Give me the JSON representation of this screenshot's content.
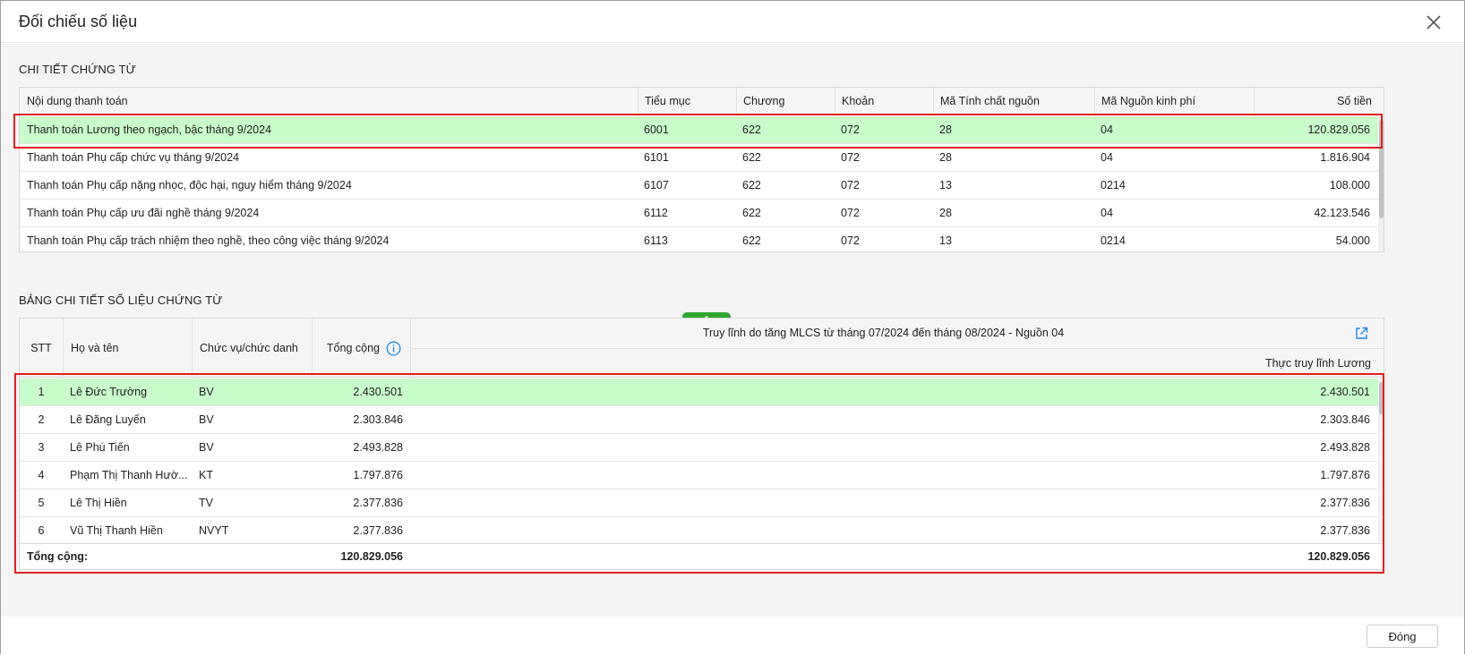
{
  "dialog": {
    "title": "Đối chiếu số liệu",
    "close_label": "Đóng"
  },
  "section1": {
    "title": "CHI TIẾT CHỨNG TỪ",
    "columns": [
      "Nội dung thanh toán",
      "Tiểu mục",
      "Chương",
      "Khoản",
      "Mã Tính chất nguồn",
      "Mã Nguồn kinh phí",
      "Số tiền"
    ],
    "rows": [
      [
        "Thanh toán Lương theo ngạch, bậc tháng 9/2024",
        "6001",
        "622",
        "072",
        "28",
        "04",
        "120.829.056"
      ],
      [
        "Thanh toán Phụ cấp chức vụ tháng 9/2024",
        "6101",
        "622",
        "072",
        "28",
        "04",
        "1.816.904"
      ],
      [
        "Thanh toán Phụ cấp nặng nhọc, độc hại, nguy hiểm tháng 9/2024",
        "6107",
        "622",
        "072",
        "13",
        "0214",
        "108.000"
      ],
      [
        "Thanh toán Phụ cấp ưu đãi nghề tháng 9/2024",
        "6112",
        "622",
        "072",
        "28",
        "04",
        "42.123.546"
      ],
      [
        "Thanh toán Phụ cấp trách nhiệm theo nghề, theo công việc tháng 9/2024",
        "6113",
        "622",
        "072",
        "13",
        "0214",
        "54.000"
      ]
    ]
  },
  "section2": {
    "title": "BẢNG CHI TIẾT SỐ LIỆU CHỨNG TỪ",
    "columns": {
      "stt": "STT",
      "name": "Họ và tên",
      "position": "Chức vụ/chức danh",
      "total": "Tổng cộng"
    },
    "group_header": "Truy lĩnh do tăng MLCS từ tháng 07/2024 đến tháng 08/2024 - Nguồn 04",
    "sub_header": "Thực truy lĩnh Lương",
    "rows": [
      [
        "1",
        "Lê Đức Trường",
        "BV",
        "2.430.501",
        "2.430.501"
      ],
      [
        "2",
        "Lê Đăng Luyến",
        "BV",
        "2.303.846",
        "2.303.846"
      ],
      [
        "3",
        "Lê Phú Tiến",
        "BV",
        "2.493.828",
        "2.493.828"
      ],
      [
        "4",
        "Phạm Thị Thanh Hườ...",
        "KT",
        "1.797.876",
        "1.797.876"
      ],
      [
        "5",
        "Lê Thị Hiền",
        "TV",
        "2.377.836",
        "2.377.836"
      ],
      [
        "6",
        "Vũ Thị Thanh Hiền",
        "NVYT",
        "2.377.836",
        "2.377.836"
      ]
    ],
    "summary": {
      "label": "Tổng cộng:",
      "total": "120.829.056",
      "value": "120.829.056"
    }
  },
  "icons": {
    "close": "close-icon",
    "info": "info-icon",
    "external_link": "external-link-icon",
    "collapse": "chevron-up-icon"
  },
  "colors": {
    "selected_row": "#c9fccb",
    "highlight_border": "#e02020",
    "collapse_button": "#2fa52f",
    "info_icon": "#1e88e5"
  }
}
